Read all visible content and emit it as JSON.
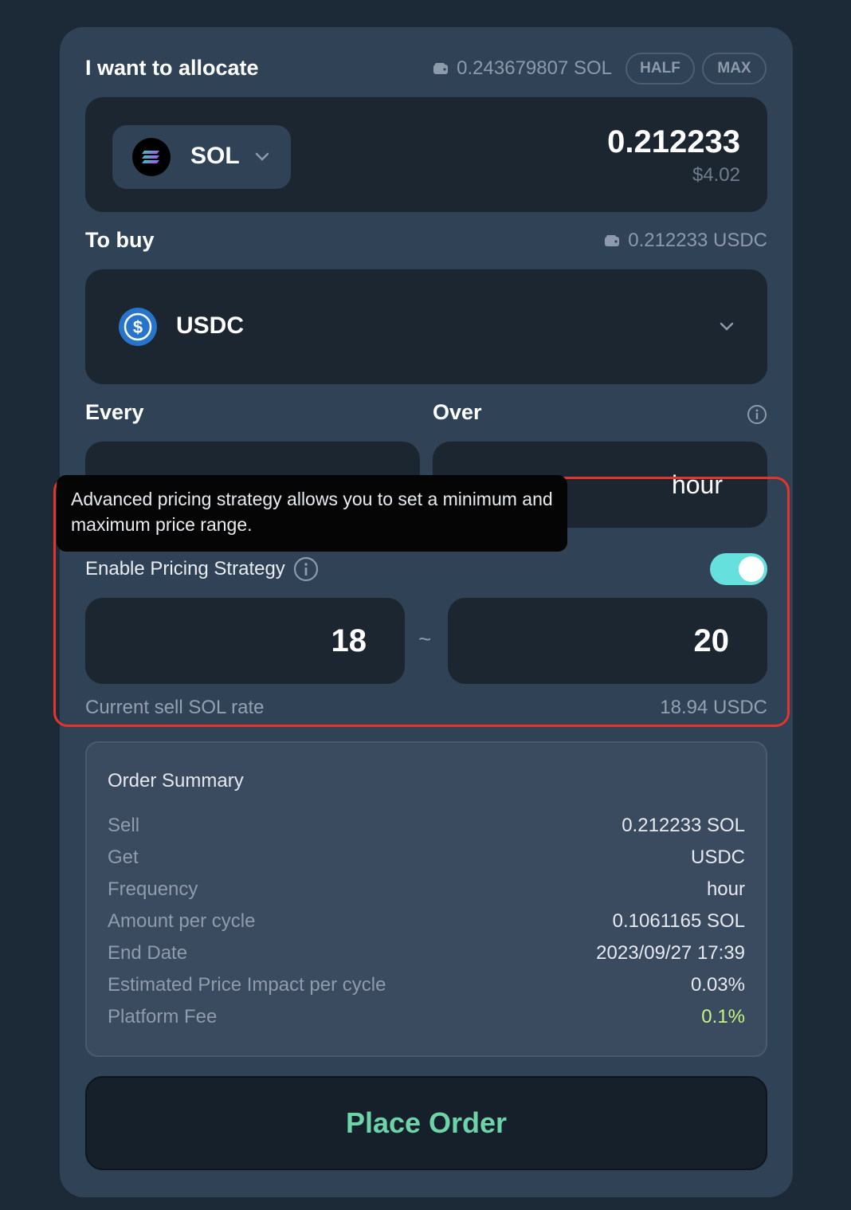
{
  "allocate": {
    "label": "I want to allocate",
    "balance": "0.243679807 SOL",
    "half_label": "HALF",
    "max_label": "MAX",
    "token": "SOL",
    "amount": "0.212233",
    "usd_value": "$4.02"
  },
  "buy": {
    "label": "To buy",
    "balance": "0.212233 USDC",
    "token": "USDC"
  },
  "every": {
    "label": "Every"
  },
  "over": {
    "label": "Over",
    "unit": "hour"
  },
  "tooltip": {
    "text": "Advanced pricing strategy allows you to set a minimum and maximum price range."
  },
  "pricing": {
    "label": "Enable Pricing Strategy",
    "enabled": true,
    "min": "18",
    "separator": "~",
    "max": "20",
    "rate_label": "Current sell SOL rate",
    "rate_value": "18.94 USDC"
  },
  "summary": {
    "title": "Order Summary",
    "rows": [
      {
        "label": "Sell",
        "value": "0.212233 SOL"
      },
      {
        "label": "Get",
        "value": "USDC"
      },
      {
        "label": "Frequency",
        "value": "hour"
      },
      {
        "label": "Amount per cycle",
        "value": "0.1061165 SOL"
      },
      {
        "label": "End Date",
        "value": "2023/09/27 17:39"
      },
      {
        "label": "Estimated Price Impact per cycle",
        "value": "0.03%"
      },
      {
        "label": "Platform Fee",
        "value": "0.1%"
      }
    ]
  },
  "place_order": {
    "label": "Place Order"
  },
  "colors": {
    "card": "#304256",
    "panel": "#1c2631",
    "toggle_on": "#66e0dc",
    "place_order_text": "#6fd3a9",
    "fee_green": "#c4f580",
    "highlight_border": "#e2362c"
  }
}
